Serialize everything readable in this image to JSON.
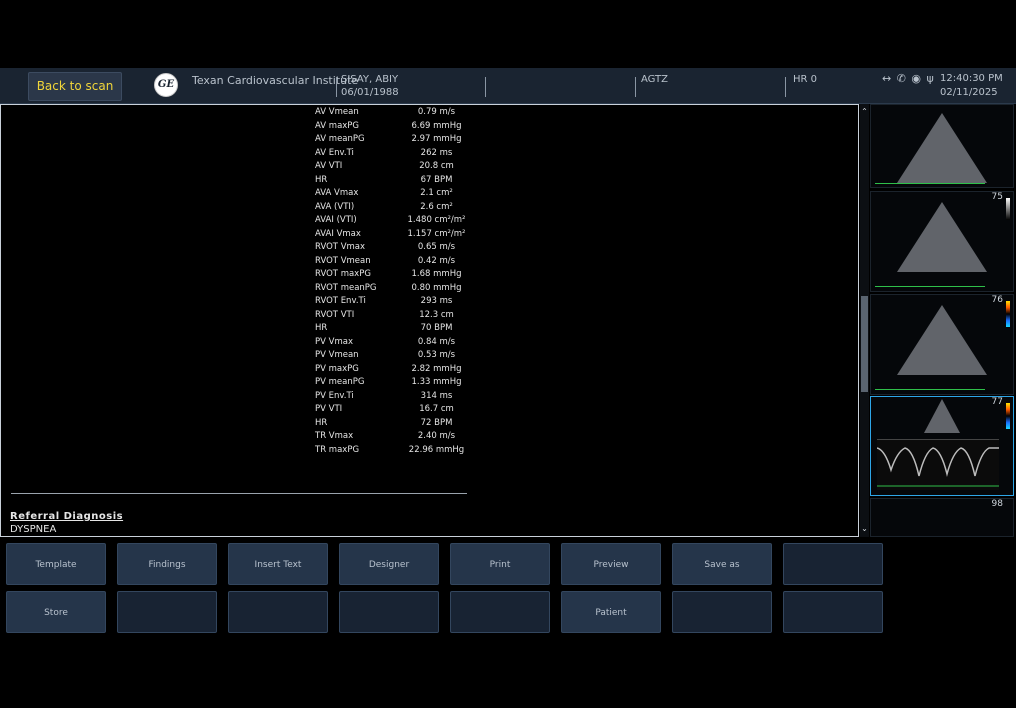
{
  "header": {
    "back_label": "Back to scan",
    "logo_text": "GE",
    "hospital": "Texan Cardiovascular Institute",
    "patient_name": "SISAY, ABIY",
    "patient_dob": "06/01/1988",
    "protocol": "AGTZ",
    "hr": "HR 0",
    "status_icons": "↔ ✆ ◉ ψ",
    "time": "12:40:30 PM",
    "date": "02/11/2025"
  },
  "measurements": [
    {
      "label": "AV Vmean",
      "value": "0.79 m/s"
    },
    {
      "label": "AV maxPG",
      "value": "6.69 mmHg"
    },
    {
      "label": "AV meanPG",
      "value": "2.97 mmHg"
    },
    {
      "label": "AV Env.Ti",
      "value": "262 ms"
    },
    {
      "label": "AV VTI",
      "value": "20.8 cm"
    },
    {
      "label": "HR",
      "value": "67 BPM"
    },
    {
      "label": "AVA Vmax",
      "value": "2.1 cm²"
    },
    {
      "label": "AVA (VTI)",
      "value": "2.6 cm²"
    },
    {
      "label": "AVAI (VTI)",
      "value": "1.480 cm²/m²"
    },
    {
      "label": "AVAI Vmax",
      "value": "1.157 cm²/m²"
    },
    {
      "label": "RVOT Vmax",
      "value": "0.65 m/s"
    },
    {
      "label": "RVOT Vmean",
      "value": "0.42 m/s"
    },
    {
      "label": "RVOT maxPG",
      "value": "1.68 mmHg"
    },
    {
      "label": "RVOT meanPG",
      "value": "0.80 mmHg"
    },
    {
      "label": "RVOT Env.Ti",
      "value": "293 ms"
    },
    {
      "label": "RVOT VTI",
      "value": "12.3 cm"
    },
    {
      "label": "HR",
      "value": "70 BPM"
    },
    {
      "label": "PV Vmax",
      "value": "0.84 m/s"
    },
    {
      "label": "PV Vmean",
      "value": "0.53 m/s"
    },
    {
      "label": "PV maxPG",
      "value": "2.82 mmHg"
    },
    {
      "label": "PV meanPG",
      "value": "1.33 mmHg"
    },
    {
      "label": "PV Env.Ti",
      "value": "314 ms"
    },
    {
      "label": "PV VTI",
      "value": "16.7 cm"
    },
    {
      "label": "HR",
      "value": "72 BPM"
    },
    {
      "label": "TR Vmax",
      "value": "2.40 m/s"
    },
    {
      "label": "TR maxPG",
      "value": "22.96 mmHg"
    }
  ],
  "referral": {
    "title": "Referral Diagnosis",
    "value": "DYSPNEA"
  },
  "scroll_icons": {
    "up": "⌃",
    "down": "⌄"
  },
  "thumbnails": [
    "",
    "75",
    "76",
    "77",
    "98"
  ],
  "buttons_row1": [
    "Template",
    "Findings",
    "Insert Text",
    "Designer",
    "Print",
    "Preview",
    "Save as",
    ""
  ],
  "buttons_row2": [
    "Store",
    "",
    "",
    "",
    "",
    "Patient",
    "",
    ""
  ],
  "colors": {
    "accent_yellow": "#f0d53a",
    "selected_thumb": "#2ea6e8",
    "button_bg": "#25354a",
    "topbar_bg": "#1a2431"
  }
}
